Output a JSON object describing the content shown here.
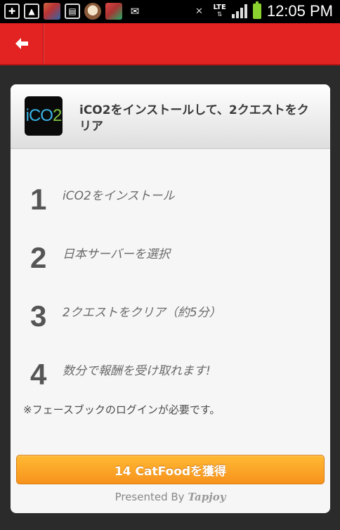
{
  "status_bar": {
    "network": "LTE",
    "time": "12:05 PM"
  },
  "header": {
    "back_icon": "back-arrow-icon",
    "brand_color": "#e32222"
  },
  "offer": {
    "app_icon_text": "iCO",
    "app_icon_sub": "2",
    "title": "iCO2をインストールして、2クエストをクリア",
    "steps": [
      {
        "num": "1",
        "text": "iCO2をインストール"
      },
      {
        "num": "2",
        "text": "日本サーバーを選択"
      },
      {
        "num": "3",
        "text": "2クエストをクリア（約5分）"
      },
      {
        "num": "4",
        "text": "数分で報酬を受け取れます!"
      }
    ],
    "note": "※フェースブックのログインが必要です。",
    "cta_label": "14 CatFoodを獲得",
    "cta_color": "#f7931d",
    "presented_by": "Presented By",
    "provider": "Tapjoy"
  }
}
